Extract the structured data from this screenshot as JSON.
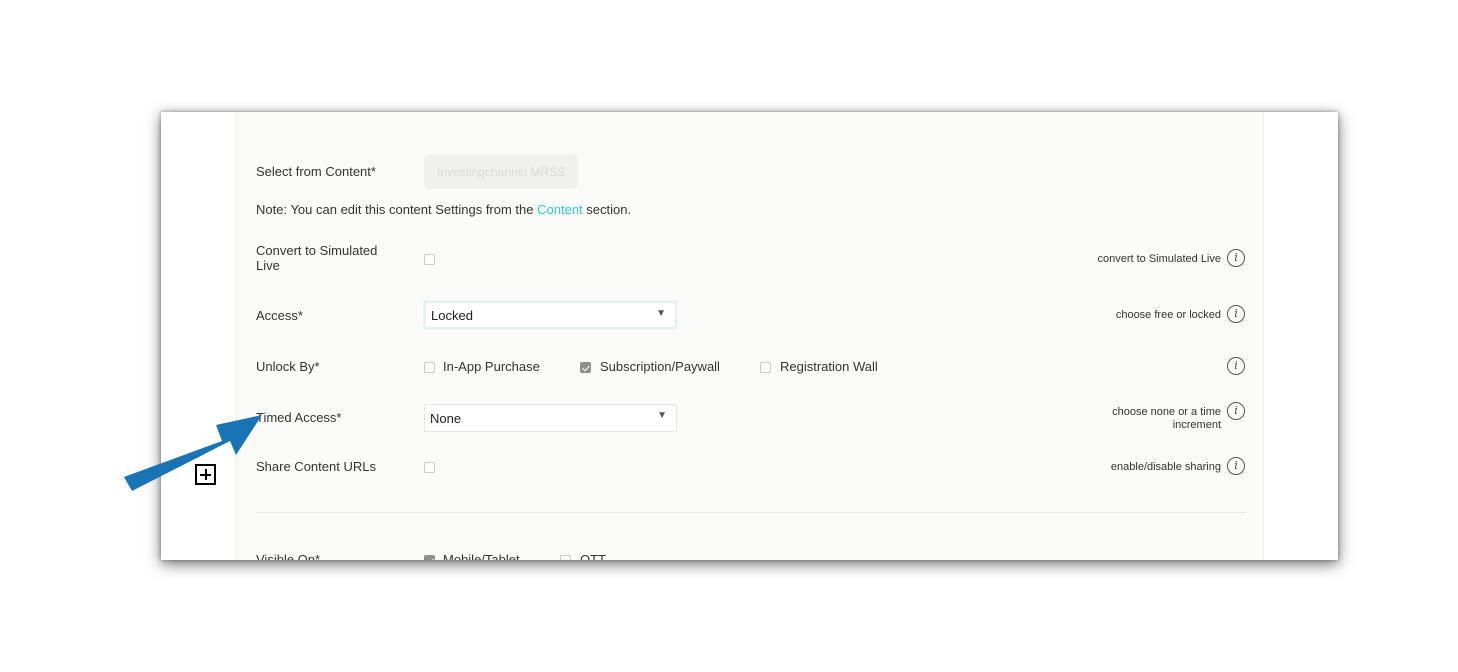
{
  "form": {
    "select_content_label": "Select from Content*",
    "content_value": "Investingchannel MRSS",
    "note_prefix": "Note: You can edit this content Settings from the ",
    "note_link": "Content",
    "note_suffix": " section.",
    "simulated_live": {
      "label": "Convert to Simulated Live",
      "checked": false,
      "hint": "convert to Simulated Live"
    },
    "access": {
      "label": "Access*",
      "value": "Locked",
      "hint": "choose free or locked"
    },
    "unlock_by": {
      "label": "Unlock By*",
      "options": [
        {
          "label": "In-App Purchase",
          "checked": false
        },
        {
          "label": "Subscription/Paywall",
          "checked": true
        },
        {
          "label": "Registration Wall",
          "checked": false
        }
      ]
    },
    "timed_access": {
      "label": "Timed Access*",
      "value": "None",
      "hint_line1": "choose none or a time",
      "hint_line2": "increment"
    },
    "share_urls": {
      "label": "Share Content URLs",
      "checked": false,
      "hint": "enable/disable sharing"
    },
    "visible_on": {
      "label": "Visible On*",
      "options": [
        "Mobile/Tablet",
        "OTT"
      ]
    }
  },
  "icons": {
    "info": "i",
    "dropdown": "▼"
  },
  "colors": {
    "link": "#35c3d6",
    "arrow": "#1a73b5"
  }
}
